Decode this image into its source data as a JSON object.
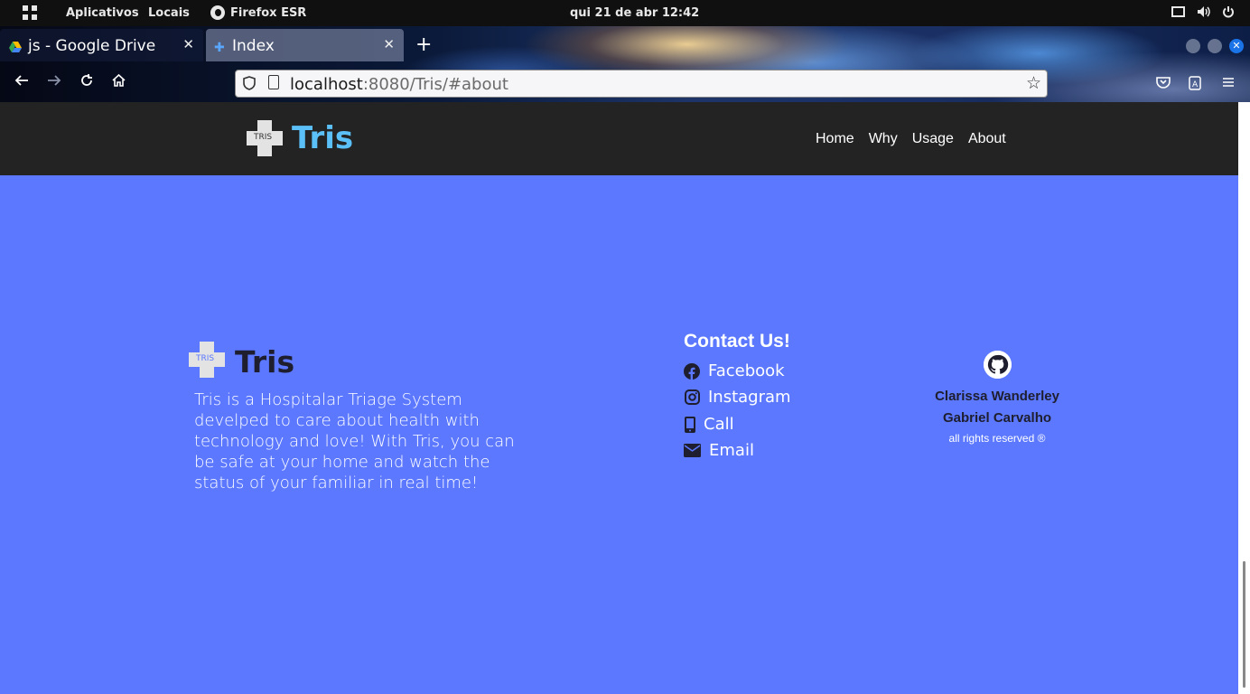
{
  "topbar": {
    "apps_label": "Aplicativos",
    "places_label": "Locais",
    "browser_label": "Firefox ESR",
    "datetime": "qui 21 de abr  12:42"
  },
  "browser": {
    "tabs": [
      {
        "title": "js - Google Drive",
        "active": false
      },
      {
        "title": "Index",
        "active": true
      }
    ],
    "new_tab": "+",
    "url_host": "localhost",
    "url_rest": ":8080/Tris/#about"
  },
  "site": {
    "logo_badge": "TRIS",
    "brand": "Tris",
    "nav": [
      "Home",
      "Why",
      "Usage",
      "About"
    ],
    "about": {
      "brand": "Tris",
      "description": "Tris is a Hospitalar Triage System develped to care about health with technology and love! With Tris, you can be safe at your home and watch the status of your familiar in real time!"
    },
    "contact": {
      "title": "Contact Us!",
      "items": [
        {
          "label": "Facebook",
          "icon": "facebook-icon"
        },
        {
          "label": "Instagram",
          "icon": "instagram-icon"
        },
        {
          "label": "Call",
          "icon": "phone-icon"
        },
        {
          "label": "Email",
          "icon": "envelope-icon"
        }
      ]
    },
    "credits": {
      "author1": "Clarissa Wanderley",
      "author2": "Gabriel Carvalho",
      "rights": "all rights reserved ®"
    },
    "colors": {
      "page_bg": "#5b78ff",
      "navbar_bg": "#232323",
      "brand_accent": "#5bc0f8"
    }
  }
}
